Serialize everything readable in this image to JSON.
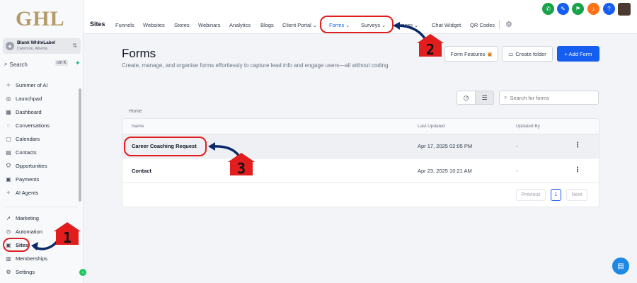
{
  "brand": {
    "logo_text": "GHL"
  },
  "account": {
    "name": "Blank WhiteLabel",
    "location": "Canmore, Alberta"
  },
  "sidebar": {
    "search_label": "Search",
    "search_shortcut": "ctrl K",
    "items": [
      {
        "label": "Summer of AI",
        "icon": "sparkle-icon"
      },
      {
        "label": "Launchpad",
        "icon": "rocket-icon"
      },
      {
        "label": "Dashboard",
        "icon": "grid-icon"
      },
      {
        "label": "Conversations",
        "icon": "chat-icon"
      },
      {
        "label": "Calendars",
        "icon": "calendar-icon"
      },
      {
        "label": "Contacts",
        "icon": "contacts-icon"
      },
      {
        "label": "Opportunities",
        "icon": "funnel-icon"
      },
      {
        "label": "Payments",
        "icon": "payments-icon"
      },
      {
        "label": "AI Agents",
        "icon": "sparkle-icon"
      },
      {
        "label": "Marketing",
        "icon": "send-icon"
      },
      {
        "label": "Automation",
        "icon": "automation-icon"
      },
      {
        "label": "Sites",
        "icon": "sites-icon"
      },
      {
        "label": "Memberships",
        "icon": "memberships-icon"
      },
      {
        "label": "Settings",
        "icon": "gear-icon"
      }
    ],
    "active_item": "Sites"
  },
  "header": {
    "section": "Sites",
    "tabs": [
      {
        "label": "Funnels"
      },
      {
        "label": "Websites"
      },
      {
        "label": "Stores"
      },
      {
        "label": "Webinars"
      },
      {
        "label": "Analytics"
      },
      {
        "label": "Blogs"
      },
      {
        "label": "Client Portal",
        "dropdown": true
      },
      {
        "label": "Forms",
        "dropdown": true,
        "active": true
      },
      {
        "label": "Surveys",
        "dropdown": true
      },
      {
        "label": "izzes",
        "dropdown": true
      },
      {
        "label": "Chat Widget"
      },
      {
        "label": "QR Codes"
      }
    ]
  },
  "main": {
    "title": "Forms",
    "description": "Create, manage, and organise forms effortlessly to capture lead info and engage users—all without coding",
    "buttons": {
      "form_features": "Form Features",
      "create_folder": "Create folder",
      "add_form": "+ Add Form"
    },
    "search_placeholder": "Search for forms",
    "breadcrumb": "Home",
    "table": {
      "columns": [
        "Name",
        "Last Updated",
        "Updated By"
      ],
      "rows": [
        {
          "name": "Career Coaching Request",
          "last_updated": "Apr 17, 2025 02:05 PM",
          "updated_by": "-"
        },
        {
          "name": "Contact",
          "last_updated": "Apr 23, 2025 10:21 AM",
          "updated_by": "-"
        }
      ]
    },
    "pagination": {
      "previous": "Previous",
      "current": "1",
      "next": "Next"
    }
  },
  "annotations": {
    "step1": "1",
    "step2": "2",
    "step3": "3"
  },
  "colors": {
    "accent": "#155eef",
    "annotation": "#e11d1d",
    "logo": "#b59a6a"
  }
}
